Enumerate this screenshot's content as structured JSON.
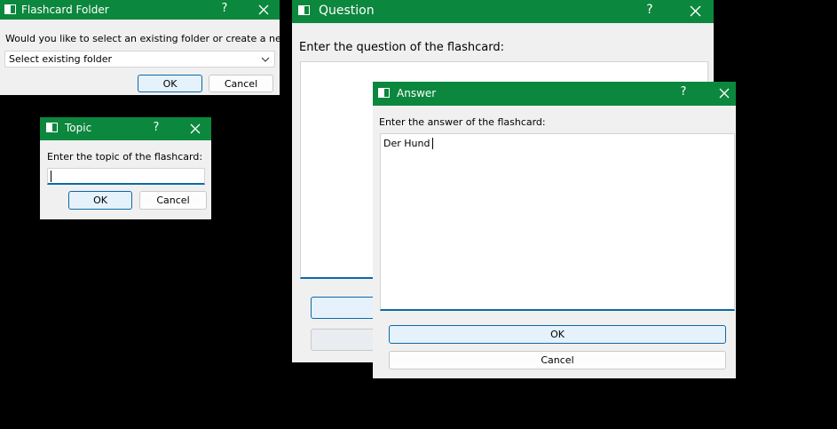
{
  "folder_dialog": {
    "title": "Flashcard Folder",
    "prompt": "Would you like to select an existing folder or create a new one?",
    "select_value": "Select existing folder",
    "ok_label": "OK",
    "cancel_label": "Cancel",
    "help_glyph": "?"
  },
  "topic_dialog": {
    "title": "Topic",
    "prompt": "Enter the topic of the flashcard:",
    "input_value": "",
    "ok_label": "OK",
    "cancel_label": "Cancel",
    "help_glyph": "?"
  },
  "question_dialog": {
    "title": "Question",
    "prompt": "Enter the question of the flashcard:",
    "help_glyph": "?"
  },
  "answer_dialog": {
    "title": "Answer",
    "prompt": "Enter the answer of the flashcard:",
    "text_value": "Der Hund",
    "ok_label": "OK",
    "cancel_label": "Cancel",
    "help_glyph": "?"
  },
  "colors": {
    "titlebar": "#0c873e",
    "dialog_bg": "#f0f0f0",
    "accent_blue": "#0c6aa8",
    "desktop": "#000000"
  }
}
